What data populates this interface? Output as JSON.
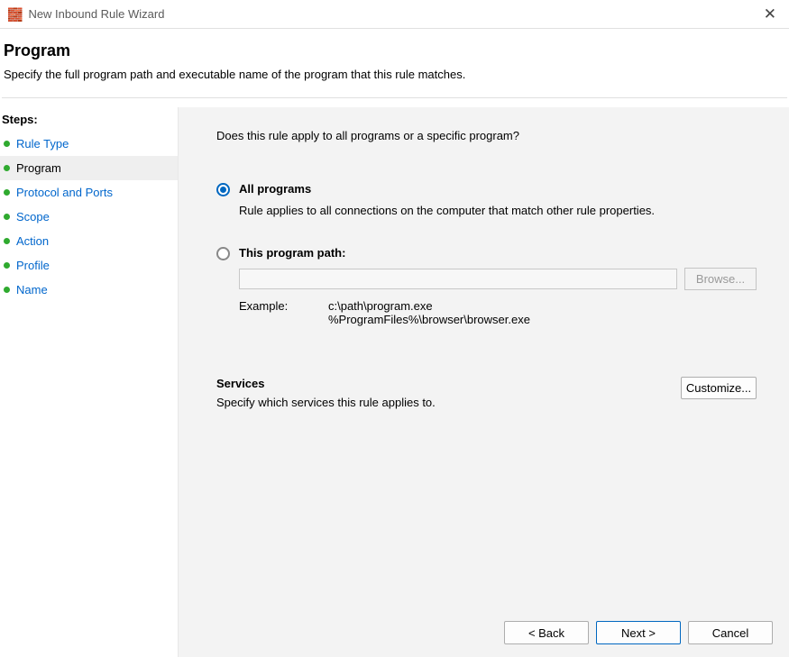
{
  "window": {
    "title": "New Inbound Rule Wizard"
  },
  "header": {
    "title": "Program",
    "subtitle": "Specify the full program path and executable name of the program that this rule matches."
  },
  "sidebar": {
    "heading": "Steps:",
    "items": [
      "Rule Type",
      "Program",
      "Protocol and Ports",
      "Scope",
      "Action",
      "Profile",
      "Name"
    ],
    "current_index": 1
  },
  "main": {
    "question": "Does this rule apply to all programs or a specific program?",
    "option_all": {
      "label": "All programs",
      "desc": "Rule applies to all connections on the computer that match other rule properties.",
      "selected": true
    },
    "option_path": {
      "label": "This program path:",
      "value": "",
      "browse": "Browse...",
      "example_label": "Example:",
      "example_paths": "c:\\path\\program.exe\n%ProgramFiles%\\browser\\browser.exe",
      "selected": false
    },
    "services": {
      "heading": "Services",
      "sub": "Specify which services this rule applies to.",
      "button": "Customize..."
    }
  },
  "footer": {
    "back": "< Back",
    "next": "Next >",
    "cancel": "Cancel"
  }
}
